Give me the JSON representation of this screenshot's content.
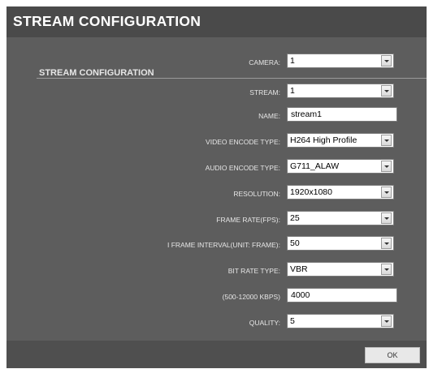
{
  "dialog": {
    "title": "STREAM CONFIGURATION",
    "section_header": "STREAM CONFIGURATION",
    "ok_label": "OK"
  },
  "fields": {
    "camera": {
      "label": "CAMERA:",
      "value": "1"
    },
    "stream": {
      "label": "STREAM:",
      "value": "1"
    },
    "name": {
      "label": "NAME:",
      "value": "stream1"
    },
    "video_encode_type": {
      "label": "VIDEO ENCODE TYPE:",
      "value": "H264 High Profile"
    },
    "audio_encode_type": {
      "label": "AUDIO ENCODE TYPE:",
      "value": "G711_ALAW"
    },
    "resolution": {
      "label": "RESOLUTION:",
      "value": "1920x1080"
    },
    "frame_rate": {
      "label": "FRAME RATE(FPS):",
      "value": "25"
    },
    "i_frame_interval": {
      "label": "I FRAME INTERVAL(UNIT: FRAME):",
      "value": "50"
    },
    "bit_rate_type": {
      "label": "BIT RATE TYPE:",
      "value": "VBR"
    },
    "bit_rate": {
      "label": "(500-12000 KBPS)",
      "value": "4000"
    },
    "quality": {
      "label": "QUALITY:",
      "value": "5"
    }
  },
  "icons": {
    "dropdown": "chevron-down-icon"
  },
  "colors": {
    "dialog_background": "#5d5d5d",
    "title_bar": "#4a4a4a",
    "footer": "#4f4f4f",
    "text": "#e6e6e6"
  }
}
